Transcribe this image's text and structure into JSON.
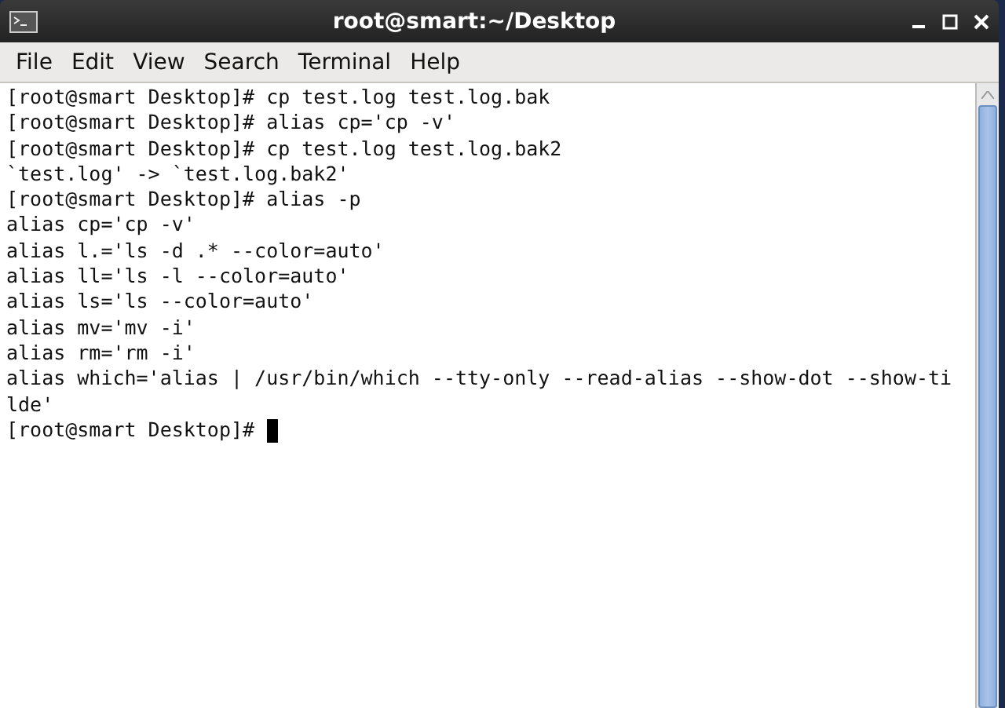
{
  "window": {
    "title": "root@smart:~/Desktop"
  },
  "menu": [
    "File",
    "Edit",
    "View",
    "Search",
    "Terminal",
    "Help"
  ],
  "terminal": {
    "lines": [
      "[root@smart Desktop]# cp test.log test.log.bak",
      "[root@smart Desktop]# alias cp='cp -v'",
      "[root@smart Desktop]# cp test.log test.log.bak2",
      "`test.log' -> `test.log.bak2'",
      "[root@smart Desktop]# alias -p",
      "alias cp='cp -v'",
      "alias l.='ls -d .* --color=auto'",
      "alias ll='ls -l --color=auto'",
      "alias ls='ls --color=auto'",
      "alias mv='mv -i'",
      "alias rm='rm -i'",
      "alias which='alias | /usr/bin/which --tty-only --read-alias --show-dot --show-ti",
      "lde'",
      "[root@smart Desktop]#"
    ],
    "cursor": true
  }
}
